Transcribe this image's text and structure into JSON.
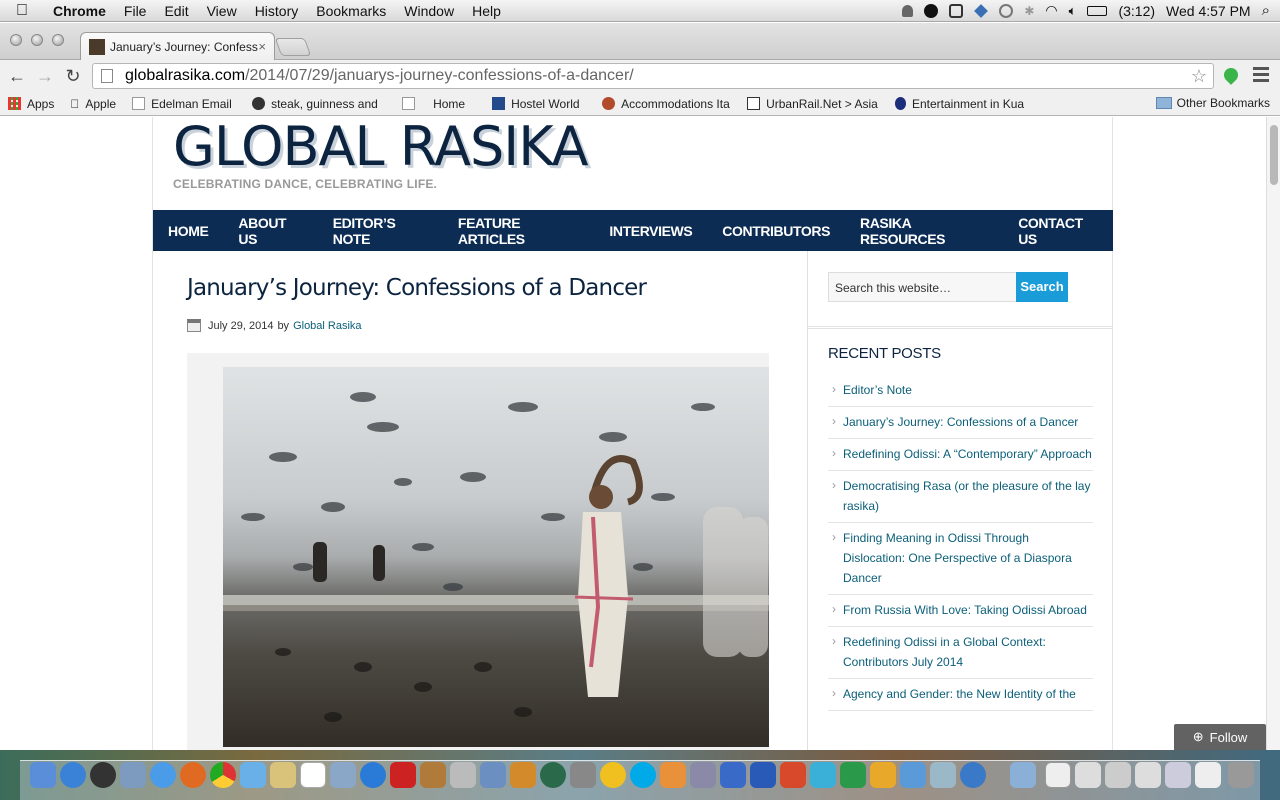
{
  "menubar": {
    "apple": "",
    "items": [
      "Chrome",
      "File",
      "Edit",
      "View",
      "History",
      "Bookmarks",
      "Window",
      "Help"
    ],
    "battery": "(3:12)",
    "clock": "Wed 4:57 PM"
  },
  "browser": {
    "tab_title": "January’s Journey: Confess",
    "tab_close": "×",
    "url_host": "globalrasika.com",
    "url_path": "/2014/07/29/januarys-journey-confessions-of-a-dancer/",
    "bookmarks": [
      "Apps",
      "Apple",
      "Edelman Email",
      "steak, guinness and",
      "Home",
      "Hostel World",
      "Accommodations Ita",
      "UrbanRail.Net > Asia",
      "Entertainment in Kua"
    ],
    "other_bookmarks": "Other Bookmarks"
  },
  "site": {
    "title": "GLOBAL RASIKA",
    "tagline": "CELEBRATING DANCE, CELEBRATING LIFE.",
    "nav": [
      "HOME",
      "ABOUT US",
      "EDITOR’S NOTE",
      "FEATURE ARTICLES",
      "INTERVIEWS",
      "CONTRIBUTORS",
      "RASIKA RESOURCES",
      "CONTACT US"
    ]
  },
  "post": {
    "title": "January’s Journey: Confessions of a Dancer",
    "date": "July 29, 2014",
    "by": "by",
    "author": "Global Rasika"
  },
  "sidebar": {
    "search_placeholder": "Search this website…",
    "search_button": "Search",
    "recent_heading": "RECENT POSTS",
    "recent_posts": [
      "Editor’s Note",
      "January’s Journey: Confessions of a Dancer",
      "Redefining Odissi: A “Contemporary” Approach",
      "Democratising Rasa (or the pleasure of the lay rasika)",
      "Finding Meaning in Odissi Through Dislocation: One Perspective of a Diaspora Dancer",
      "From Russia With Love: Taking Odissi Abroad",
      "Redefining Odissi in a Global Context: Contributors July 2014",
      "Agency and Gender: the New Identity of the"
    ]
  },
  "follow": "Follow",
  "colors": {
    "nav_bg": "#0c2c54",
    "link": "#0b5f79",
    "search_button": "#1a9cd8"
  }
}
